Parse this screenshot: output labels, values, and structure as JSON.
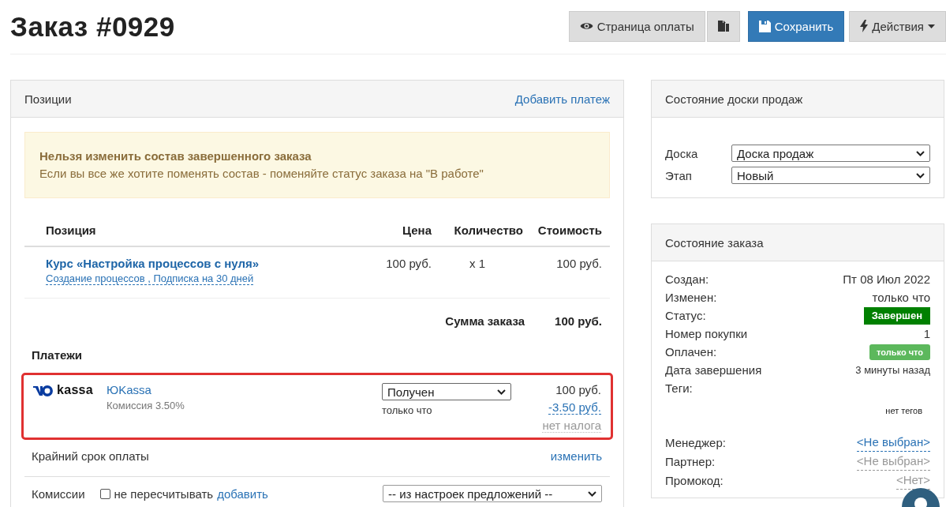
{
  "header": {
    "title": "Заказ #0929",
    "buttons": [
      {
        "kind": "eye",
        "label": "Страница оплаты"
      },
      {
        "kind": "copy"
      },
      {
        "kind": "save",
        "label": "Сохранить"
      },
      {
        "kind": "bolt",
        "label": "Действия"
      }
    ]
  },
  "positions": {
    "title": "Позиции",
    "action": "Добавить платеж",
    "alert": {
      "title": "Нельзя изменить состав завершенного заказа",
      "text": "Если вы все же хотите поменять состав - поменяйте статус заказа на \"В работе\""
    },
    "columns": [
      "Позиция",
      "Цена",
      "Количество",
      "Стоимость"
    ],
    "rows": [
      {
        "name": "Курс «Настройка процессов с нуля»",
        "details": "Создание процессов , Подписка на 30 дней",
        "price": "100 руб.",
        "quantity": "x 1",
        "cost": "100 руб."
      }
    ],
    "total_label": "Сумма заказа",
    "total": "100 руб.",
    "payments_title": "Платежи",
    "payments": [
      {
        "logo_text": "kassa",
        "name": "ЮKassa",
        "commission": "Комиссия 3.50%",
        "status": "Получен",
        "time": "только что",
        "amount": "100 руб.",
        "fee": "-3.50 руб.",
        "tax": "нет налога",
        "highlighted": true
      }
    ],
    "deadline_label": "Крайний срок оплаты",
    "deadline_action": "изменить",
    "commissions": {
      "label": "Комиссии",
      "checkbox": "не пересчитывать",
      "checked": false,
      "add": "добавить",
      "select": "-- из настроек предложений --"
    }
  },
  "board": {
    "title": "Состояние доски продаж",
    "fields": [
      {
        "label": "Доска",
        "value": "Доска продаж"
      },
      {
        "label": "Этап",
        "value": "Новый"
      }
    ]
  },
  "order_state": {
    "title": "Состояние заказа",
    "rows": [
      {
        "label": "Создан:",
        "value": "Пт 08 Июл 2022",
        "kind": "text"
      },
      {
        "label": "Изменен:",
        "value": "только что",
        "kind": "text"
      },
      {
        "label": "Статус:",
        "value": "Завершен",
        "kind": "status"
      },
      {
        "label": "Номер покупки",
        "value": "1",
        "kind": "text"
      },
      {
        "label": "Оплачен:",
        "value": "только что",
        "kind": "paid"
      },
      {
        "label": "Дата завершения",
        "value": "3 минуты назад",
        "kind": "small"
      },
      {
        "label": "Теги:",
        "value": "нет тегов",
        "kind": "tags"
      },
      {
        "label": "Менеджер:",
        "value": "<Не выбран>",
        "kind": "link"
      },
      {
        "label": "Партнер:",
        "value": "<Не выбран>",
        "kind": "muted"
      },
      {
        "label": "Промокод:",
        "value": "<Нет>",
        "kind": "muted"
      }
    ]
  }
}
